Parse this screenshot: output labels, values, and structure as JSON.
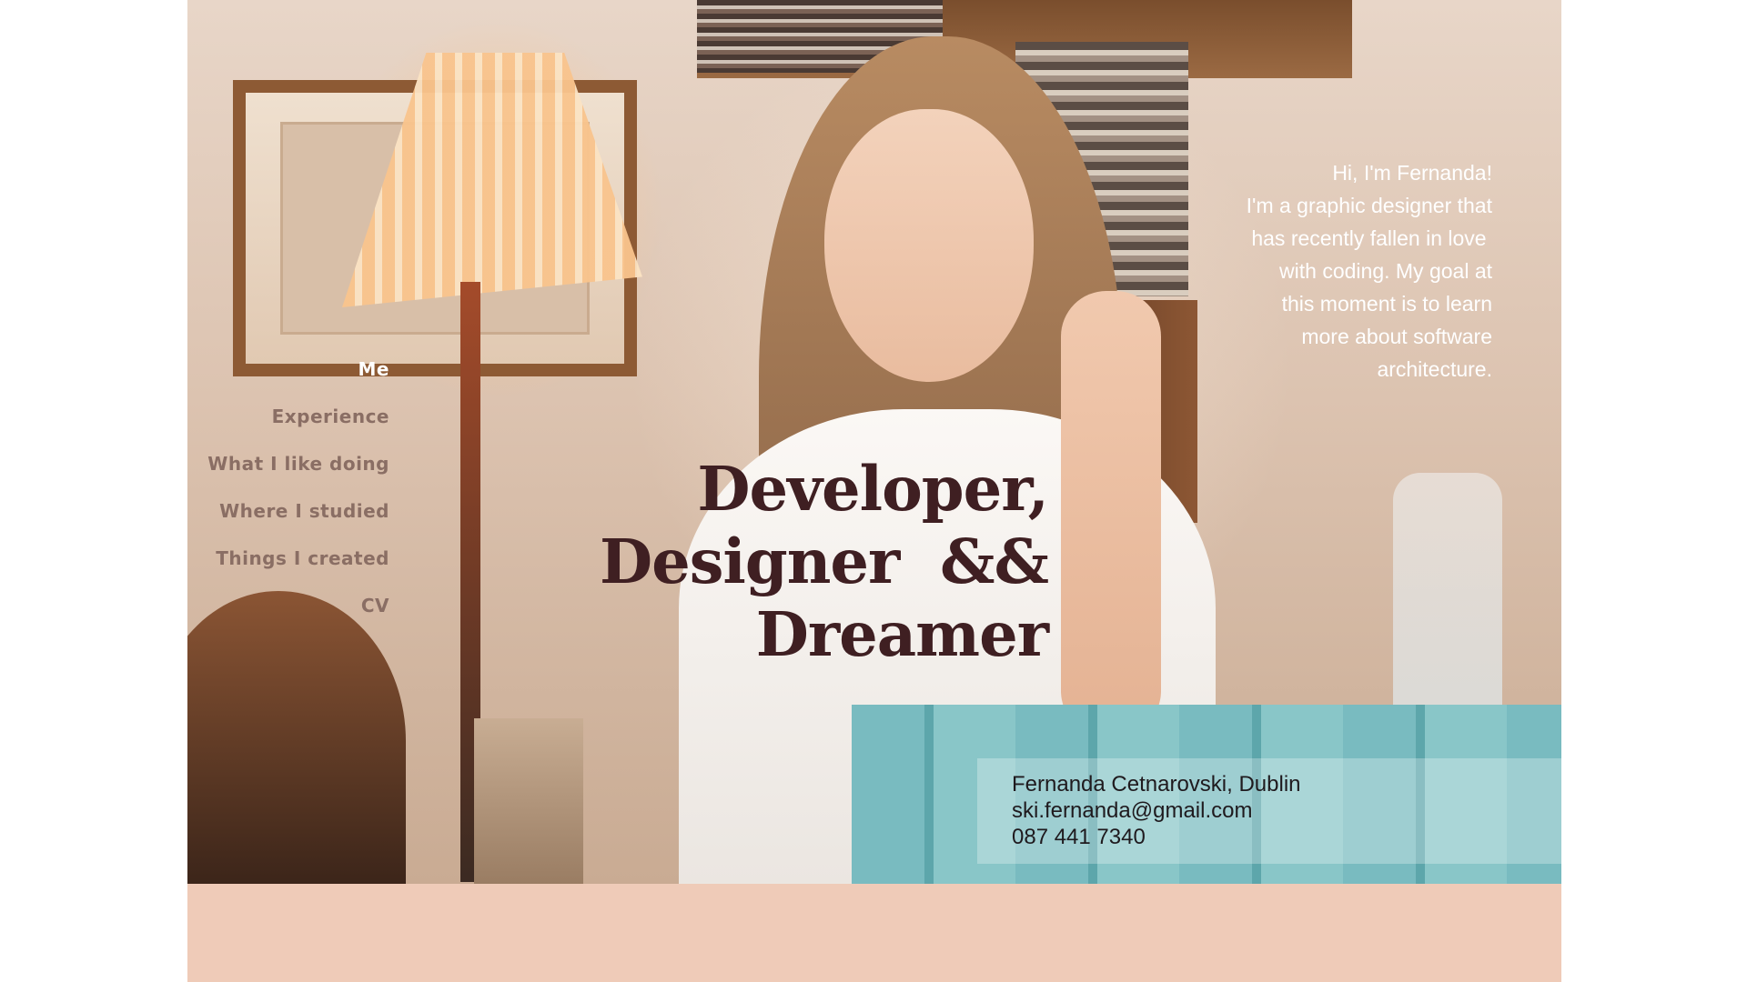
{
  "nav": {
    "items": [
      {
        "label": "Me",
        "active": true
      },
      {
        "label": "Experience",
        "active": false
      },
      {
        "label": "What I like doing",
        "active": false
      },
      {
        "label": "Where I studied",
        "active": false
      },
      {
        "label": "Things I created",
        "active": false
      },
      {
        "label": "CV",
        "active": false
      }
    ]
  },
  "headline": {
    "lines": [
      "Developer,",
      "Designer  &&",
      "Dreamer"
    ]
  },
  "intro": {
    "lines": [
      "Hi, I'm Fernanda!",
      "I'm a graphic designer that",
      "has recently fallen in love ",
      "with coding. My goal at",
      "this moment is to learn",
      "more about software",
      "architecture."
    ]
  },
  "contact": {
    "name_city": "Fernanda Cetnarovski, Dublin",
    "email": "ski.fernanda@gmail.com",
    "phone": "087 441 7340"
  },
  "colors": {
    "page_bg": "#efcbb8",
    "headline": "#3f1f22",
    "nav_inactive": "#8a6e64",
    "nav_active": "#ffffff"
  }
}
